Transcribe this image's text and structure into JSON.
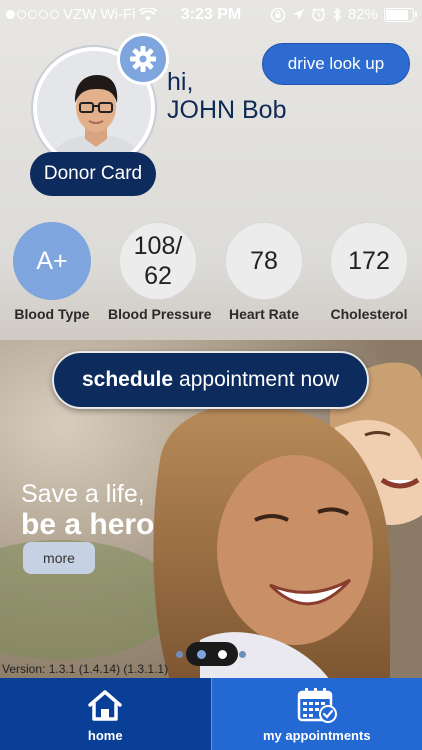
{
  "status_bar": {
    "carrier": "VZW Wi-Fi",
    "time": "3:23 PM",
    "battery": "82%",
    "battery_level": 0.82
  },
  "profile": {
    "greeting": "hi,",
    "name": "JOHN Bob",
    "donor_card_label": "Donor Card"
  },
  "header": {
    "drive_lookup_label": "drive look up"
  },
  "stats": [
    {
      "value": "A+",
      "label": "Blood Type"
    },
    {
      "value": "108/\n62",
      "label": "Blood Pressure"
    },
    {
      "value": "78",
      "label": "Heart Rate"
    },
    {
      "value": "172",
      "label": "Cholesterol"
    }
  ],
  "schedule": {
    "bold": "schedule",
    "rest": "appointment now"
  },
  "hero": {
    "line1": "Save a life,",
    "line2": "be a hero",
    "more_label": "more"
  },
  "version": "Version:  1.3.1 (1.4.14) (1.3.1.1)",
  "tabs": [
    {
      "label": "home",
      "icon": "home-icon"
    },
    {
      "label": "my appointments",
      "icon": "calendar-check-icon"
    }
  ],
  "colors": {
    "navy": "#0d2b5c",
    "accent_blue": "#2d6bd1",
    "light_blue": "#7ea5dd"
  }
}
